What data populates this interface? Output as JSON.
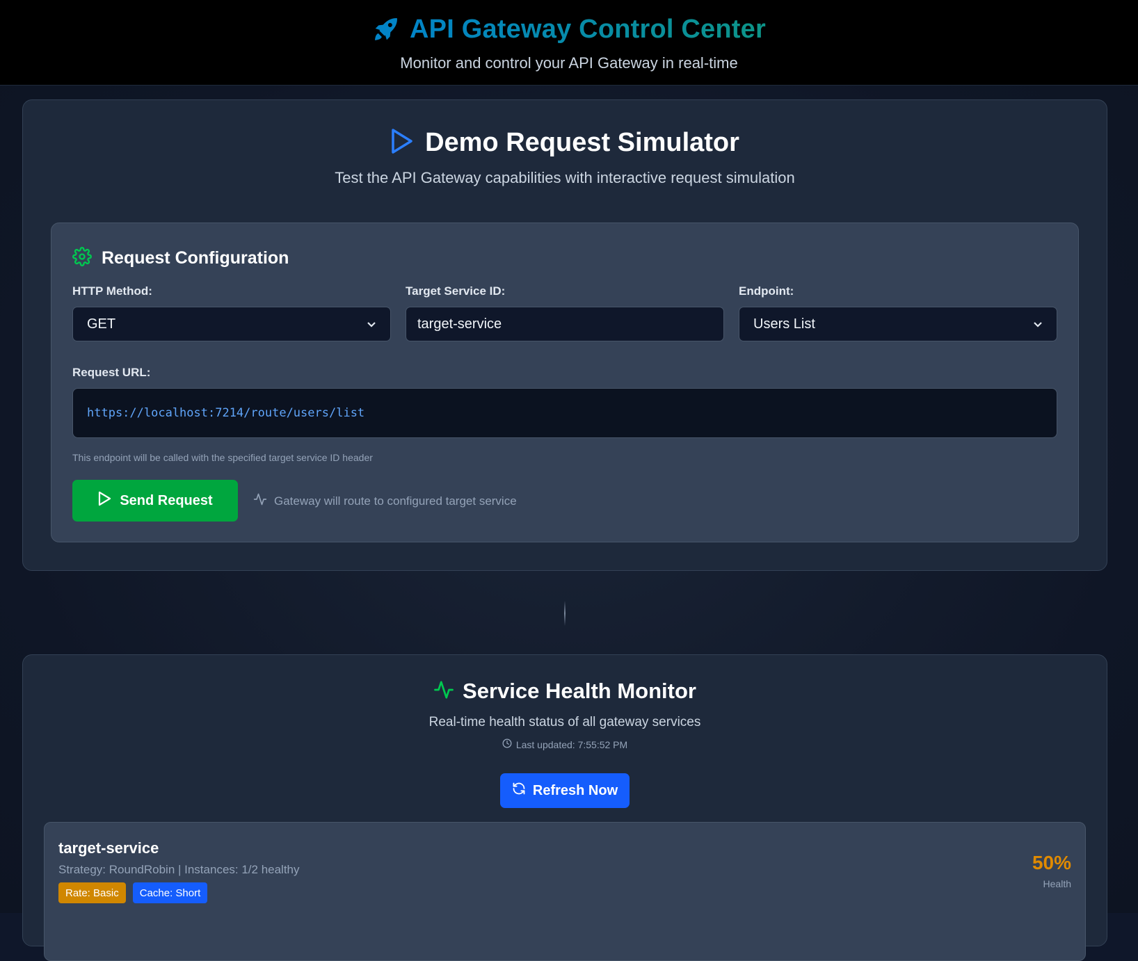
{
  "header": {
    "title": "API Gateway Control Center",
    "subtitle": "Monitor and control your API Gateway in real-time",
    "icon": "rocket-icon"
  },
  "simulator": {
    "title": "Demo Request Simulator",
    "subtitle": "Test the API Gateway capabilities with interactive request simulation",
    "icon": "play-icon",
    "config": {
      "title": "Request Configuration",
      "icon": "gear-icon",
      "method_label": "HTTP Method:",
      "method_value": "GET",
      "target_label": "Target Service ID:",
      "target_value": "target-service",
      "endpoint_label": "Endpoint:",
      "endpoint_value": "Users List",
      "url_label": "Request URL:",
      "url_value": "https://localhost:7214/route/users/list",
      "url_hint": "This endpoint will be called with the specified target service ID header",
      "send_label": "Send Request",
      "route_note": "Gateway will route to configured target service"
    }
  },
  "health": {
    "title": "Service Health Monitor",
    "icon": "activity-icon",
    "subtitle": "Real-time health status of all gateway services",
    "last_updated": "Last updated: 7:55:52 PM",
    "refresh_label": "Refresh Now",
    "services": [
      {
        "name": "target-service",
        "meta": "Strategy: RoundRobin | Instances: 1/2 healthy",
        "badges": [
          {
            "label": "Rate: Basic",
            "color": "#d08700"
          },
          {
            "label": "Cache: Short",
            "color": "#155dfc"
          }
        ],
        "health_value": "50%",
        "health_label": "Health",
        "health_color": "#e08a00"
      }
    ]
  },
  "colors": {
    "accent_blue": "#155dfc",
    "accent_green": "#00a63e",
    "title_gradient_start": "#0284c7",
    "title_gradient_end": "#0d9488",
    "url_text": "#60a5fa",
    "warning": "#e08a00"
  }
}
